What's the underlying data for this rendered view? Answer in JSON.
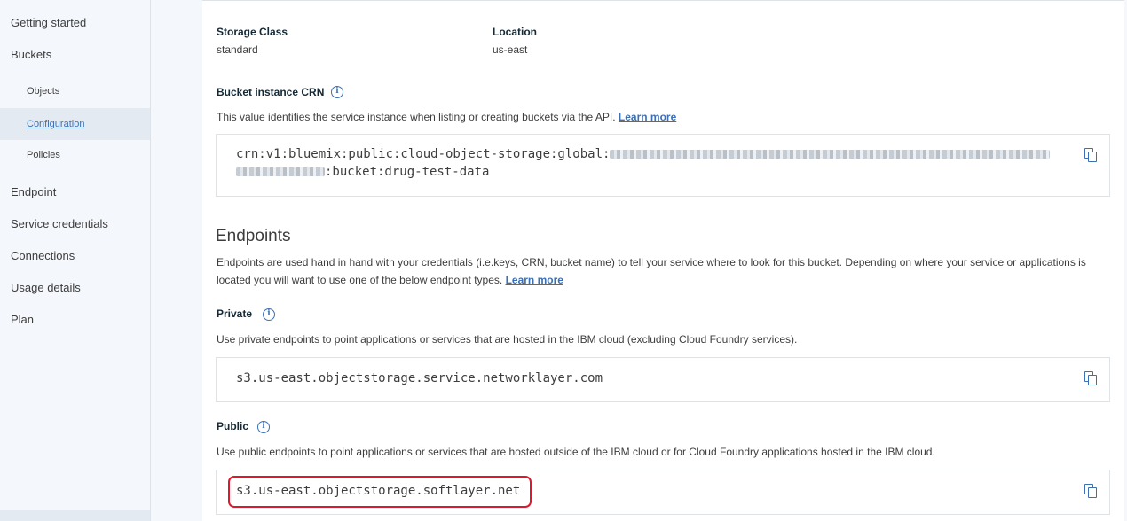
{
  "sidebar": {
    "items": [
      {
        "label": "Getting started"
      },
      {
        "label": "Buckets"
      },
      {
        "label": "Objects"
      },
      {
        "label": "Configuration"
      },
      {
        "label": "Policies"
      },
      {
        "label": "Endpoint"
      },
      {
        "label": "Service credentials"
      },
      {
        "label": "Connections"
      },
      {
        "label": "Usage details"
      },
      {
        "label": "Plan"
      }
    ],
    "active": "Configuration"
  },
  "storage": {
    "class_label": "Storage Class",
    "class_value": "standard",
    "location_label": "Location",
    "location_value": "us-east"
  },
  "crn": {
    "heading": "Bucket instance CRN",
    "description": "This value identifies the service instance when listing or creating buckets via the API.",
    "learn_more": "Learn more",
    "prefix": "crn:v1:bluemix:public:cloud-object-storage:global:",
    "suffix": ":bucket:drug-test-data"
  },
  "endpoints": {
    "heading": "Endpoints",
    "description": "Endpoints are used hand in hand with your credentials (i.e.keys, CRN, bucket name) to tell your service where to look for this bucket. Depending on where your service or applications is located you will want to use one of the below endpoint types.",
    "learn_more": "Learn more",
    "private": {
      "heading": "Private",
      "description": "Use private endpoints to point applications or services that are hosted in the IBM cloud (excluding Cloud Foundry services).",
      "value": "s3.us-east.objectstorage.service.networklayer.com"
    },
    "public": {
      "heading": "Public",
      "description": "Use public endpoints to point applications or services that are hosted outside of the IBM cloud or for Cloud Foundry applications hosted in the IBM cloud.",
      "value": "s3.us-east.objectstorage.softlayer.net"
    }
  },
  "icons": {
    "info": "info-icon",
    "copy": "copy-icon"
  },
  "colors": {
    "accent": "#3d70b2",
    "highlight": "#e0182d",
    "sidebar_bg": "#f4f7fb"
  }
}
